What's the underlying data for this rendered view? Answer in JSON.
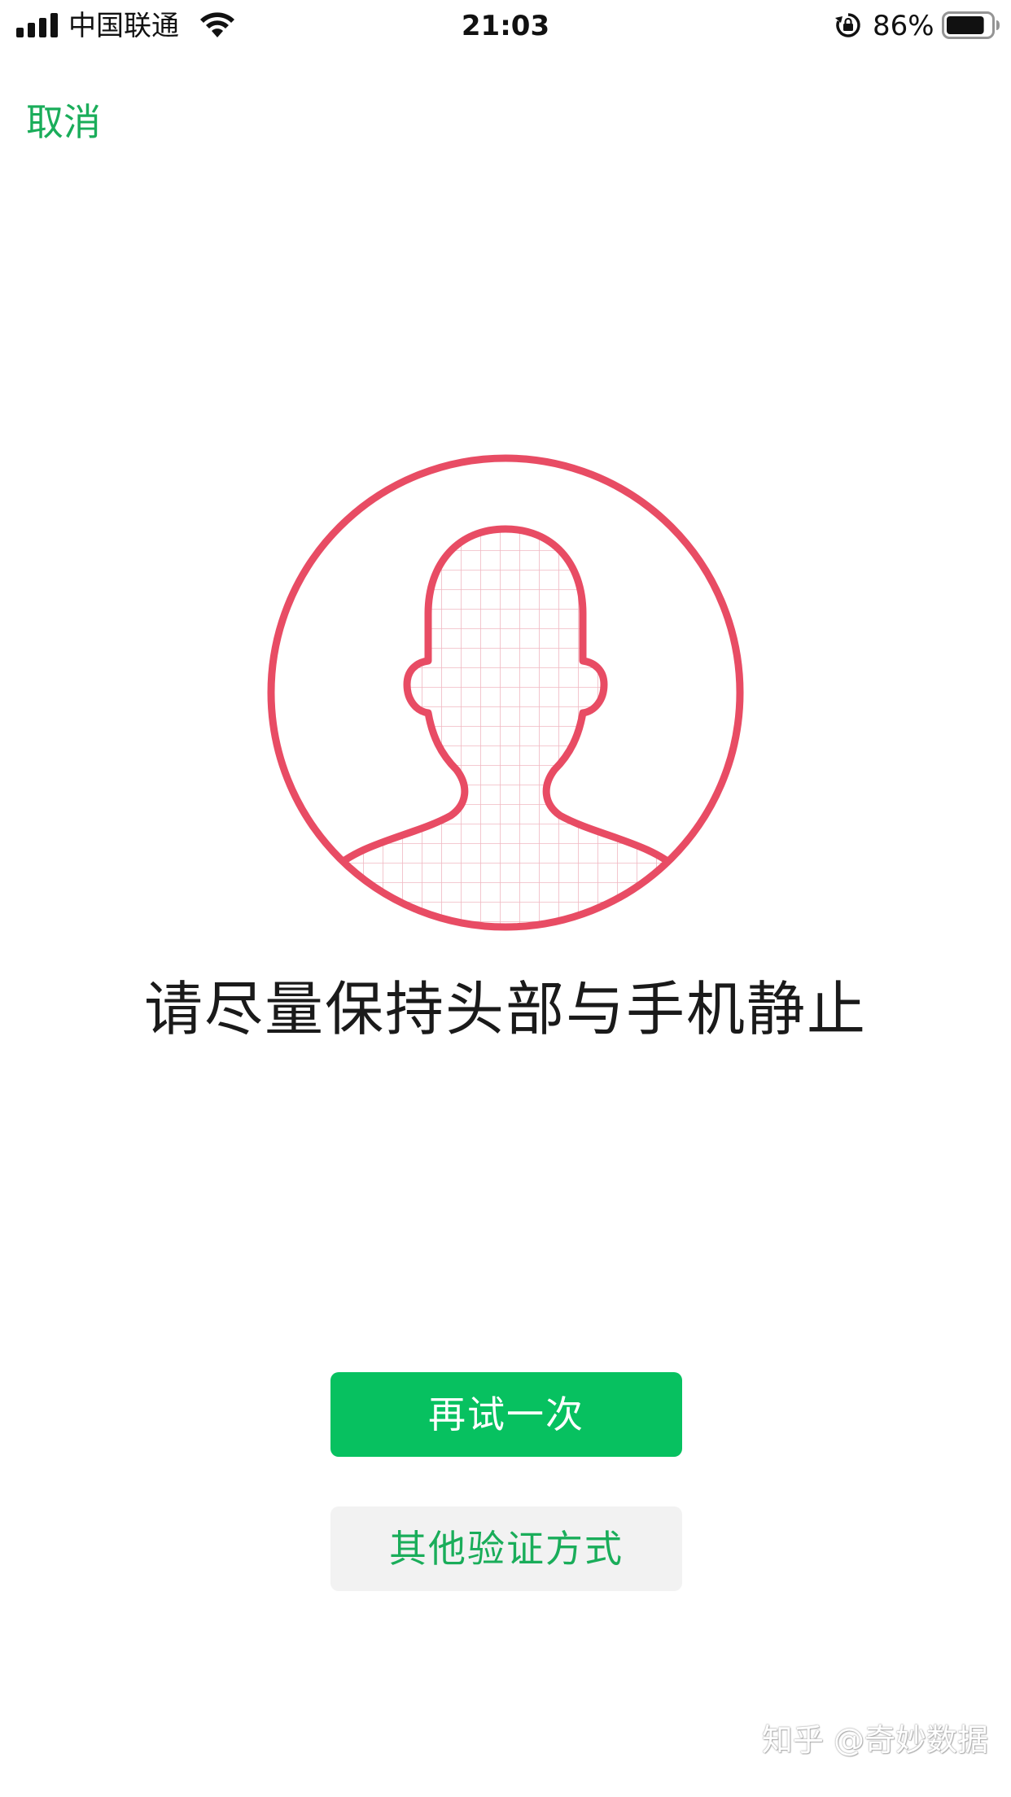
{
  "status_bar": {
    "carrier": "中国联通",
    "time": "21:03",
    "battery_percent_label": "86%",
    "battery_level": 0.86,
    "signal_bars": 4,
    "icons": [
      "signal-icon",
      "wifi-icon",
      "rotation-lock-icon",
      "battery-icon"
    ]
  },
  "nav": {
    "cancel_label": "取消"
  },
  "colors": {
    "accent_green": "#07c160",
    "link_green": "#1aad5a",
    "frame_red": "#e84c64",
    "secondary_button_bg": "#f2f2f2"
  },
  "face_frame": {
    "icon": "face-silhouette-icon"
  },
  "instruction": "请尽量保持头部与手机静止",
  "buttons": {
    "retry_label": "再试一次",
    "other_method_label": "其他验证方式"
  },
  "watermark": "知乎 @奇妙数据"
}
